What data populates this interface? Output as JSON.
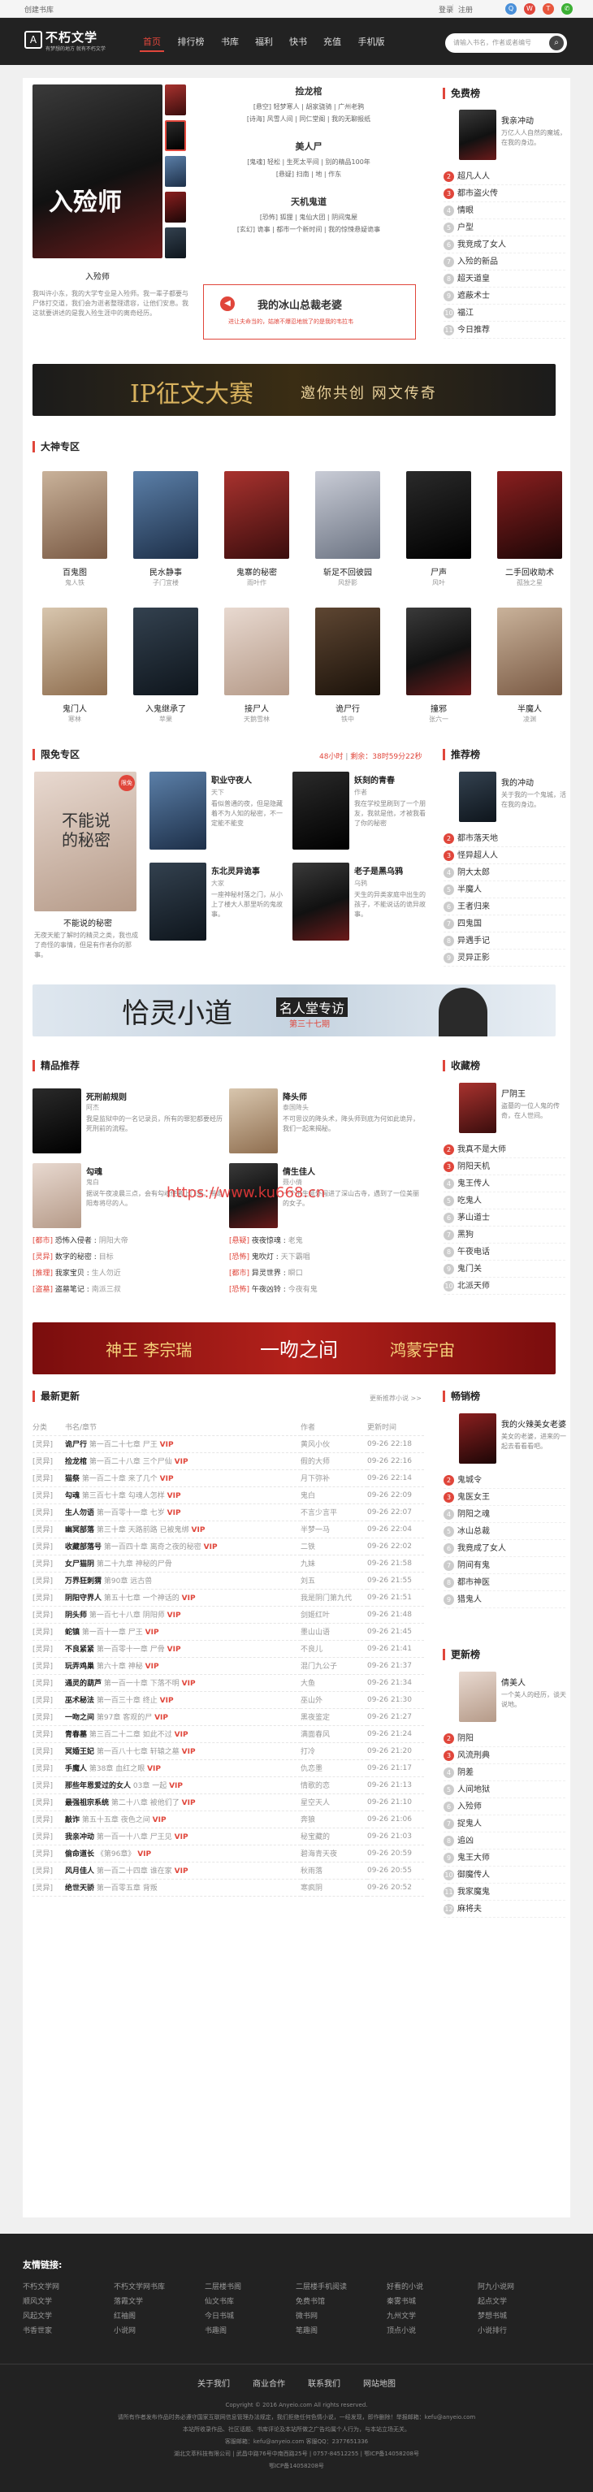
{
  "topbar": {
    "links": "创建书库",
    "login": "登录",
    "sep": "|",
    "reg": "注册"
  },
  "logo": {
    "name": "不朽文学",
    "slogan": "有梦想的地方 就有不朽文学",
    "mark": "A"
  },
  "nav": [
    "首页",
    "排行榜",
    "书库",
    "福利",
    "快书",
    "充值",
    "手机版"
  ],
  "search": {
    "placeholder": "请输入书名，作者或者编号",
    "icon": "search-icon"
  },
  "hero": {
    "book": {
      "title": "入殓师",
      "tag": "入殓师",
      "desc": "我叫许小东，我的大学专业是入殓师。我一辈子都要与尸体打交道，我们会为逝者整理遗容，让他们安息。我这就要讲述的是我入殓生涯中的离奇经历。"
    },
    "items": [
      {
        "h": "捡龙棺",
        "l1": "[悬空] 轻梦寒人 | 胡家骁骑 | 广州老鸦",
        "l2": "[诗海] 风雪人间 | 同仁堂阁 | 我的无聊报纸"
      },
      {
        "h": "美人尸",
        "l1": "[鬼魂] 轻松 | 生死太平间 | 别的精品100年",
        "l2": "[悬疑] 扫南 | 地 | 作东"
      },
      {
        "h": "天机鬼道",
        "l1": "[恐怖] 狐狸 | 鬼仙大团 | 阴间鬼屋",
        "l2": "[玄幻] 诡事 | 都市一个新时间 | 我的惊悚悬疑诡事"
      }
    ],
    "promo": {
      "title": "我的冰山总裁老婆",
      "sub": "进让夫命当的，姑娘不爆忍地就了的是我的韦拉韦"
    }
  },
  "free": {
    "title": "免费榜",
    "top": {
      "title": "我亲冲动",
      "desc": "万亿人人自然的魔城，在我的身边。"
    },
    "items": [
      "超凡人人",
      "都市盗火传",
      "情眼",
      "户型",
      "我竞成了女人",
      "入殓的新品",
      "超天道皇",
      "遮蔽术士",
      "福江",
      "今日推荐"
    ]
  },
  "ban1": {
    "t1": "IP征文大赛",
    "t2": "邀你共创 网文传奇"
  },
  "gods": {
    "title": "大神专区",
    "books": [
      {
        "t": "百鬼图",
        "a": "鬼人铁"
      },
      {
        "t": "民水静事",
        "a": "子门宜楼"
      },
      {
        "t": "鬼寨的秘密",
        "a": "雨叶作"
      },
      {
        "t": "斩足不回彼园",
        "a": "风舒影"
      },
      {
        "t": "尸声",
        "a": "风叶"
      },
      {
        "t": "二手回收助术",
        "a": "孤独之星"
      },
      {
        "t": "鬼门人",
        "a": "寒林"
      },
      {
        "t": "入鬼继承了",
        "a": "苹果"
      },
      {
        "t": "接尸人",
        "a": "天鹅雪林"
      },
      {
        "t": "诡尸行",
        "a": "铁中"
      },
      {
        "t": "撞邪",
        "a": "张六一"
      },
      {
        "t": "半魔人",
        "a": "凌渊"
      }
    ]
  },
  "limited": {
    "title": "限免专区",
    "timer": "48小时",
    "timer2": "剩余：38时59分22秒",
    "main": {
      "t": "不能说的秘密",
      "d": "无夜天能了解时的精灵之类，我也成了奇怪的事情，但是有作者你的那事。",
      "cover": "不能说的秘密"
    },
    "books": [
      {
        "t": "职业守夜人",
        "a": "天下",
        "d": "看似普通的夜，但是隐藏着不为人知的秘密，不一定能不能变"
      },
      {
        "t": "妖刻的青春",
        "a": "作者",
        "d": "我在学校里刷到了一个朋友，我就是他，才被我看了你的秘密"
      },
      {
        "t": "东北灵异诡事",
        "a": "大家",
        "d": "一座神秘村落之门，从小上了楼大人那里听的鬼故事。"
      },
      {
        "t": "老子是黑乌鸦",
        "a": "乌鸦",
        "d": "天生的异类家庭中出生的孩子，不能说话的诡异故事。"
      }
    ]
  },
  "recommend": {
    "title": "推荐榜",
    "top": {
      "title": "我的冲动",
      "desc": "关于我的一个鬼城，活在我的身边。"
    },
    "items": [
      "都市落天地",
      "怪异超人人",
      "阴大太郎",
      "半魔人",
      "王者归来",
      "四鬼国",
      "异遇手记",
      "灵异正影"
    ]
  },
  "ban2": {
    "t1": "恰灵小道",
    "t2": "名人堂专访",
    "t3": "第三十七期"
  },
  "fine": {
    "title": "精品推荐",
    "books": [
      {
        "t": "死刑前规则",
        "a": "阿杰",
        "d": "我是监狱中的一名记录员，所有的罪犯都要经历死刑前的流程。"
      },
      {
        "t": "降头师",
        "a": "泰国降头",
        "d": "不可思议的降头术，降头师到底为何如此诡异，我们一起来揭秘。"
      },
      {
        "t": "勾魂",
        "a": "鬼白",
        "d": "据说午夜凌晨三点，会有勾魂使者上门来，带走阳寿将尽的人。"
      },
      {
        "t": "倩生佳人",
        "a": "聂小倩",
        "d": "一个书生意外闯进了深山古寺，遇到了一位美丽的女子。"
      }
    ],
    "list": [
      {
        "c": "[都市]",
        "t": "恐怖入侵者",
        "a": "阴阳大帝"
      },
      {
        "c": "[悬疑]",
        "t": "夜夜惊魂",
        "a": "老鬼"
      },
      {
        "c": "[灵异]",
        "t": "数字的秘密",
        "a": "目标"
      },
      {
        "c": "[恐怖]",
        "t": "鬼吹灯",
        "a": "天下霸唱"
      },
      {
        "c": "[推理]",
        "t": "我家宝贝",
        "a": "生人勿近"
      },
      {
        "c": "[都市]",
        "t": "异灵世界",
        "a": "瞬口"
      },
      {
        "c": "[盗墓]",
        "t": "盗墓笔记",
        "a": "南派三叔"
      },
      {
        "c": "[恐怖]",
        "t": "午夜凶铃",
        "a": "今夜有鬼"
      }
    ]
  },
  "collect": {
    "title": "收藏榜",
    "top": {
      "title": "尸阴王",
      "desc": "盗墓的一位人鬼的传奇，在人世间。"
    },
    "items": [
      "我真不是大师",
      "阴阳天机",
      "鬼王传人",
      "吃鬼人",
      "茅山道士",
      "黑狗",
      "午夜电话",
      "鬼门关",
      "北派天师"
    ]
  },
  "ban3": {
    "t1": "神王 李宗瑞",
    "t2": "一吻之间",
    "t3": "鸿蒙宇宙"
  },
  "watermark": "https://www.ku668.cn",
  "latest": {
    "title": "最新更新",
    "more": "更新推荐小说 >>",
    "headers": [
      "分类",
      "书名/章节",
      "作者",
      "更新时间"
    ],
    "rows": [
      {
        "c": "[灵异]",
        "t": "诡尸行",
        "ch": "第一百二十七章 尸王",
        "v": "VIP",
        "a": "黄风小伙",
        "d": "09-26 22:18"
      },
      {
        "c": "[灵异]",
        "t": "捡龙棺",
        "ch": "第一百二十八章 三个尸仙",
        "v": "VIP",
        "a": "假的大师",
        "d": "09-26 22:16"
      },
      {
        "c": "[灵异]",
        "t": "猫祭",
        "ch": "第一百二十章 来了几个",
        "v": "VIP",
        "a": "月下弥补",
        "d": "09-26 22:14"
      },
      {
        "c": "[灵异]",
        "t": "勾魂",
        "ch": "第三百七十章 勾魂人怎样",
        "v": "VIP",
        "a": "鬼白",
        "d": "09-26 22:09"
      },
      {
        "c": "[灵异]",
        "t": "生人勿语",
        "ch": "第一百零十一章 七岁",
        "v": "VIP",
        "a": "不言少言平",
        "d": "09-26 22:07"
      },
      {
        "c": "[灵异]",
        "t": "幽冥部落",
        "ch": "第三十章 天路前路 已被鬼绑",
        "v": "VIP",
        "a": "半梦一马",
        "d": "09-26 22:04"
      },
      {
        "c": "[灵异]",
        "t": "收藏部落号",
        "ch": "第一百四十章 离奇之夜的秘密",
        "v": "VIP",
        "a": "二铁",
        "d": "09-26 22:02"
      },
      {
        "c": "[灵异]",
        "t": "女尸猫阴",
        "ch": "第二十九章 神秘的尸骨",
        "v": "",
        "a": "九妹",
        "d": "09-26 21:58"
      },
      {
        "c": "[灵异]",
        "t": "万界狂刺猬",
        "ch": "第90章 远古兽",
        "v": "",
        "a": "刘五",
        "d": "09-26 21:55"
      },
      {
        "c": "[灵异]",
        "t": "阴阳守界人",
        "ch": "第五十七章 一个神话的",
        "v": "VIP",
        "a": "我是阴门第九代",
        "d": "09-26 21:51"
      },
      {
        "c": "[灵异]",
        "t": "阴头师",
        "ch": "第一百七十八章 阴阳师",
        "v": "VIP",
        "a": "剑姬红叶",
        "d": "09-26 21:48"
      },
      {
        "c": "[灵异]",
        "t": "蛇镇",
        "ch": "第一百十一章 尸王",
        "v": "VIP",
        "a": "墨山山语",
        "d": "09-26 21:45"
      },
      {
        "c": "[灵异]",
        "t": "不良紧紧",
        "ch": "第一百零十一章 尸骨",
        "v": "VIP",
        "a": "不良儿",
        "d": "09-26 21:41"
      },
      {
        "c": "[灵异]",
        "t": "玩弄鸡巢",
        "ch": "第六十章 神秘",
        "v": "VIP",
        "a": "混门九公子",
        "d": "09-26 21:37"
      },
      {
        "c": "[灵异]",
        "t": "通灵的葫芦",
        "ch": "第一百一十章 下落不明",
        "v": "VIP",
        "a": "大鱼",
        "d": "09-26 21:34"
      },
      {
        "c": "[灵异]",
        "t": "巫术秘法",
        "ch": "第一百三十章 终止",
        "v": "VIP",
        "a": "巫山外",
        "d": "09-26 21:30"
      },
      {
        "c": "[灵异]",
        "t": "一吻之间",
        "ch": "第97章 客观的尸",
        "v": "VIP",
        "a": "黑夜鉴定",
        "d": "09-26 21:27"
      },
      {
        "c": "[灵异]",
        "t": "青春墓",
        "ch": "第三百二十二章 如此不过",
        "v": "VIP",
        "a": "满面春风",
        "d": "09-26 21:24"
      },
      {
        "c": "[灵异]",
        "t": "冥婚王妃",
        "ch": "第一百八十七章 轩辕之墓",
        "v": "VIP",
        "a": "打冷",
        "d": "09-26 21:20"
      },
      {
        "c": "[灵异]",
        "t": "手魔人",
        "ch": "第38章 血红之眼",
        "v": "VIP",
        "a": "仇恋墨",
        "d": "09-26 21:17"
      },
      {
        "c": "[灵异]",
        "t": "那些年恩爱过的女人",
        "ch": "03章 一起",
        "v": "VIP",
        "a": "情歌的恋",
        "d": "09-26 21:13"
      },
      {
        "c": "[灵异]",
        "t": "最强祖宗系统",
        "ch": "第二十八章 被他们了",
        "v": "VIP",
        "a": "星空天人",
        "d": "09-26 21:10"
      },
      {
        "c": "[灵异]",
        "t": "敲诈",
        "ch": "第五十五章 夜色之间",
        "v": "VIP",
        "a": "奔狼",
        "d": "09-26 21:06"
      },
      {
        "c": "[灵异]",
        "t": "我亲冲动",
        "ch": "第一百一十八章 尸王见",
        "v": "VIP",
        "a": "秘宝藏的",
        "d": "09-26 21:03"
      },
      {
        "c": "[灵异]",
        "t": "偷命道长",
        "ch": "《第96章》",
        "v": "VIP",
        "a": "碧海青天夜",
        "d": "09-26 20:59"
      },
      {
        "c": "[灵异]",
        "t": "风月佳人",
        "ch": "第一百二十四章 谁在家",
        "v": "VIP",
        "a": "秋雨落",
        "d": "09-26 20:55"
      },
      {
        "c": "[灵异]",
        "t": "绝世天骄",
        "ch": "第一百零五章 背叛",
        "v": "",
        "a": "寒疯阴",
        "d": "09-26 20:52"
      }
    ]
  },
  "hot": {
    "title": "畅销榜",
    "top": {
      "title": "我的火辣美女老婆",
      "desc": "美女的老婆，进来的一起去看看看吧。"
    },
    "items": [
      "鬼城令",
      "鬼医女王",
      "阴阳之魂",
      "冰山总裁",
      "我竟成了女人",
      "阴间有鬼",
      "都市神医",
      "猎鬼人"
    ]
  },
  "update": {
    "title": "更新榜",
    "top": {
      "title": "倩美人",
      "desc": "一个美人的经历，谈天说地。"
    },
    "items": [
      "阴阳",
      "风流刑典",
      "阴差",
      "人间地狱",
      "入殓师",
      "捉鬼人",
      "追凶",
      "鬼王大师",
      "御魔传人",
      "我家魔鬼",
      "麻将夫"
    ]
  },
  "footer": {
    "title": "友情链接:",
    "links": [
      "不朽文学网",
      "不朽文学网书库",
      "二层楼书阁",
      "二层楼手机阅读",
      "好看的小说",
      "阿九小说网",
      "顺风文学",
      "落霞文学",
      "仙文书库",
      "免费书馆",
      "秦雾书城",
      "起点文学",
      "风起文学",
      "红袖阁",
      "今日书城",
      "微书网",
      "九州文学",
      "梦想书城",
      "书香世家",
      "小说网",
      "书趣阁",
      "笔趣阁",
      "顶点小说",
      "小说排行"
    ],
    "nav": [
      "关于我们",
      "商业合作",
      "联系我们",
      "网站地图"
    ],
    "copy": [
      "Copyright © 2016 Anyeio.com All rights reserved.",
      "请所有作者发布作品时务必遵守国家互联网信息管理办法规定，我们拒绝任何色情小说，一经发现，即作删除！举报邮箱：kefu@anyeio.com",
      "本站所收录作品、社区话题、书库评论及本站所做之广告均属个人行为，与本站立场无关。",
      "客服邮箱：kefu@anyeio.com   客服QQ：2377651336",
      "湖北文萃科技有限公司 | 武昌中路76号中南西路25号 | 0757-84512255 | 鄂ICP备14058208号",
      "鄂ICP备14058208号"
    ]
  }
}
